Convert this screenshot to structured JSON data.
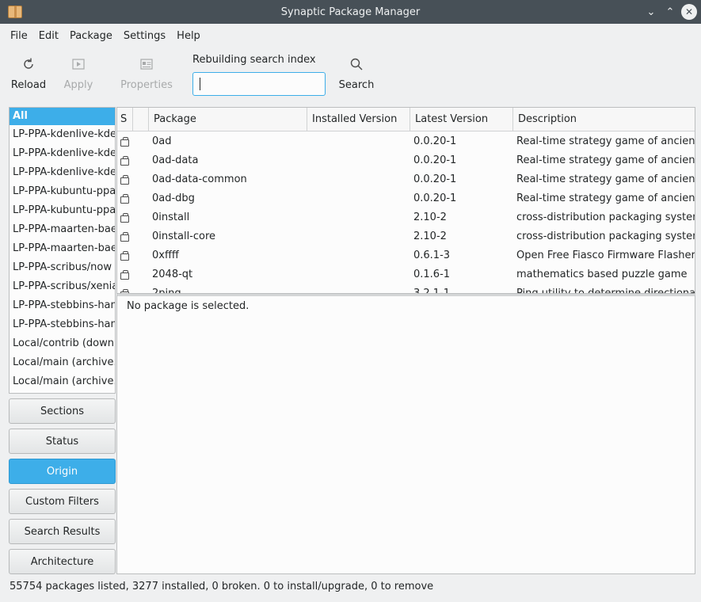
{
  "window": {
    "title": "Synaptic Package Manager",
    "icon": "package-box-icon",
    "controls": [
      "chevron-down-icon",
      "chevron-up-icon",
      "close-icon"
    ]
  },
  "menu": [
    "File",
    "Edit",
    "Package",
    "Settings",
    "Help"
  ],
  "toolbar": {
    "reload_label": "Reload",
    "apply_label": "Apply",
    "properties_label": "Properties",
    "search_caption": "Rebuilding search index",
    "search_value": "",
    "search_label": "Search"
  },
  "origins": {
    "selected": "All",
    "items": [
      "LP-PPA-kdenlive-kden",
      "LP-PPA-kdenlive-kden",
      "LP-PPA-kdenlive-kden",
      "LP-PPA-kubuntu-ppa-",
      "LP-PPA-kubuntu-ppa-",
      "LP-PPA-maarten-baer",
      "LP-PPA-maarten-baer",
      "LP-PPA-scribus/now",
      "LP-PPA-scribus/xenial",
      "LP-PPA-stebbins-hanc",
      "LP-PPA-stebbins-hanc",
      "Local/contrib (downlo",
      "Local/main (archive.ca",
      "Local/main (archive.ul"
    ]
  },
  "filters": {
    "sections": "Sections",
    "status": "Status",
    "origin": "Origin",
    "custom": "Custom Filters",
    "search_results": "Search Results",
    "architecture": "Architecture",
    "active": "Origin"
  },
  "table": {
    "headers": {
      "s": "S",
      "package": "Package",
      "installed": "Installed Version",
      "latest": "Latest Version",
      "description": "Description"
    },
    "rows": [
      {
        "package": "0ad",
        "installed": "",
        "latest": "0.0.20-1",
        "description": "Real-time strategy game of ancient wa"
      },
      {
        "package": "0ad-data",
        "installed": "",
        "latest": "0.0.20-1",
        "description": "Real-time strategy game of ancient wa"
      },
      {
        "package": "0ad-data-common",
        "installed": "",
        "latest": "0.0.20-1",
        "description": "Real-time strategy game of ancient wa"
      },
      {
        "package": "0ad-dbg",
        "installed": "",
        "latest": "0.0.20-1",
        "description": "Real-time strategy game of ancient wa"
      },
      {
        "package": "0install",
        "installed": "",
        "latest": "2.10-2",
        "description": "cross-distribution packaging system"
      },
      {
        "package": "0install-core",
        "installed": "",
        "latest": "2.10-2",
        "description": "cross-distribution packaging system (n"
      },
      {
        "package": "0xffff",
        "installed": "",
        "latest": "0.6.1-3",
        "description": "Open Free Fiasco Firmware Flasher"
      },
      {
        "package": "2048-qt",
        "installed": "",
        "latest": "0.1.6-1",
        "description": "mathematics based puzzle game"
      },
      {
        "package": "2ping",
        "installed": "",
        "latest": "3.2.1-1",
        "description": "Ping utility to determine directional pa"
      }
    ]
  },
  "details": {
    "text": "No package is selected."
  },
  "status": {
    "text": "55754 packages listed, 3277 installed, 0 broken. 0 to install/upgrade, 0 to remove"
  }
}
